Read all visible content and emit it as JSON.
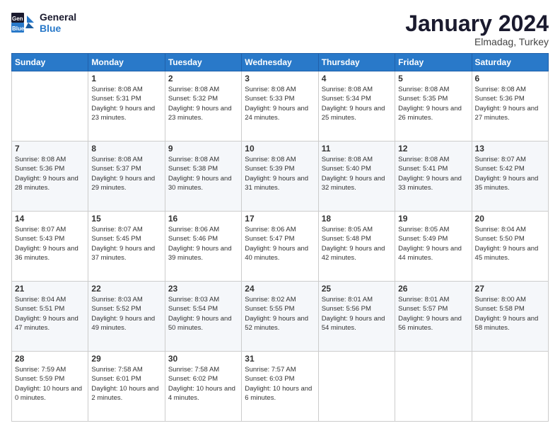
{
  "header": {
    "logo_text_general": "General",
    "logo_text_blue": "Blue",
    "month_title": "January 2024",
    "location": "Elmadag, Turkey"
  },
  "weekdays": [
    "Sunday",
    "Monday",
    "Tuesday",
    "Wednesday",
    "Thursday",
    "Friday",
    "Saturday"
  ],
  "weeks": [
    [
      {
        "day": "",
        "empty": true
      },
      {
        "day": "1",
        "sunrise": "8:08 AM",
        "sunset": "5:31 PM",
        "daylight": "9 hours and 23 minutes."
      },
      {
        "day": "2",
        "sunrise": "8:08 AM",
        "sunset": "5:32 PM",
        "daylight": "9 hours and 23 minutes."
      },
      {
        "day": "3",
        "sunrise": "8:08 AM",
        "sunset": "5:33 PM",
        "daylight": "9 hours and 24 minutes."
      },
      {
        "day": "4",
        "sunrise": "8:08 AM",
        "sunset": "5:34 PM",
        "daylight": "9 hours and 25 minutes."
      },
      {
        "day": "5",
        "sunrise": "8:08 AM",
        "sunset": "5:35 PM",
        "daylight": "9 hours and 26 minutes."
      },
      {
        "day": "6",
        "sunrise": "8:08 AM",
        "sunset": "5:36 PM",
        "daylight": "9 hours and 27 minutes."
      }
    ],
    [
      {
        "day": "7",
        "sunrise": "8:08 AM",
        "sunset": "5:36 PM",
        "daylight": "9 hours and 28 minutes."
      },
      {
        "day": "8",
        "sunrise": "8:08 AM",
        "sunset": "5:37 PM",
        "daylight": "9 hours and 29 minutes."
      },
      {
        "day": "9",
        "sunrise": "8:08 AM",
        "sunset": "5:38 PM",
        "daylight": "9 hours and 30 minutes."
      },
      {
        "day": "10",
        "sunrise": "8:08 AM",
        "sunset": "5:39 PM",
        "daylight": "9 hours and 31 minutes."
      },
      {
        "day": "11",
        "sunrise": "8:08 AM",
        "sunset": "5:40 PM",
        "daylight": "9 hours and 32 minutes."
      },
      {
        "day": "12",
        "sunrise": "8:08 AM",
        "sunset": "5:41 PM",
        "daylight": "9 hours and 33 minutes."
      },
      {
        "day": "13",
        "sunrise": "8:07 AM",
        "sunset": "5:42 PM",
        "daylight": "9 hours and 35 minutes."
      }
    ],
    [
      {
        "day": "14",
        "sunrise": "8:07 AM",
        "sunset": "5:43 PM",
        "daylight": "9 hours and 36 minutes."
      },
      {
        "day": "15",
        "sunrise": "8:07 AM",
        "sunset": "5:45 PM",
        "daylight": "9 hours and 37 minutes."
      },
      {
        "day": "16",
        "sunrise": "8:06 AM",
        "sunset": "5:46 PM",
        "daylight": "9 hours and 39 minutes."
      },
      {
        "day": "17",
        "sunrise": "8:06 AM",
        "sunset": "5:47 PM",
        "daylight": "9 hours and 40 minutes."
      },
      {
        "day": "18",
        "sunrise": "8:05 AM",
        "sunset": "5:48 PM",
        "daylight": "9 hours and 42 minutes."
      },
      {
        "day": "19",
        "sunrise": "8:05 AM",
        "sunset": "5:49 PM",
        "daylight": "9 hours and 44 minutes."
      },
      {
        "day": "20",
        "sunrise": "8:04 AM",
        "sunset": "5:50 PM",
        "daylight": "9 hours and 45 minutes."
      }
    ],
    [
      {
        "day": "21",
        "sunrise": "8:04 AM",
        "sunset": "5:51 PM",
        "daylight": "9 hours and 47 minutes."
      },
      {
        "day": "22",
        "sunrise": "8:03 AM",
        "sunset": "5:52 PM",
        "daylight": "9 hours and 49 minutes."
      },
      {
        "day": "23",
        "sunrise": "8:03 AM",
        "sunset": "5:54 PM",
        "daylight": "9 hours and 50 minutes."
      },
      {
        "day": "24",
        "sunrise": "8:02 AM",
        "sunset": "5:55 PM",
        "daylight": "9 hours and 52 minutes."
      },
      {
        "day": "25",
        "sunrise": "8:01 AM",
        "sunset": "5:56 PM",
        "daylight": "9 hours and 54 minutes."
      },
      {
        "day": "26",
        "sunrise": "8:01 AM",
        "sunset": "5:57 PM",
        "daylight": "9 hours and 56 minutes."
      },
      {
        "day": "27",
        "sunrise": "8:00 AM",
        "sunset": "5:58 PM",
        "daylight": "9 hours and 58 minutes."
      }
    ],
    [
      {
        "day": "28",
        "sunrise": "7:59 AM",
        "sunset": "5:59 PM",
        "daylight": "10 hours and 0 minutes."
      },
      {
        "day": "29",
        "sunrise": "7:58 AM",
        "sunset": "6:01 PM",
        "daylight": "10 hours and 2 minutes."
      },
      {
        "day": "30",
        "sunrise": "7:58 AM",
        "sunset": "6:02 PM",
        "daylight": "10 hours and 4 minutes."
      },
      {
        "day": "31",
        "sunrise": "7:57 AM",
        "sunset": "6:03 PM",
        "daylight": "10 hours and 6 minutes."
      },
      {
        "day": "",
        "empty": true
      },
      {
        "day": "",
        "empty": true
      },
      {
        "day": "",
        "empty": true
      }
    ]
  ]
}
